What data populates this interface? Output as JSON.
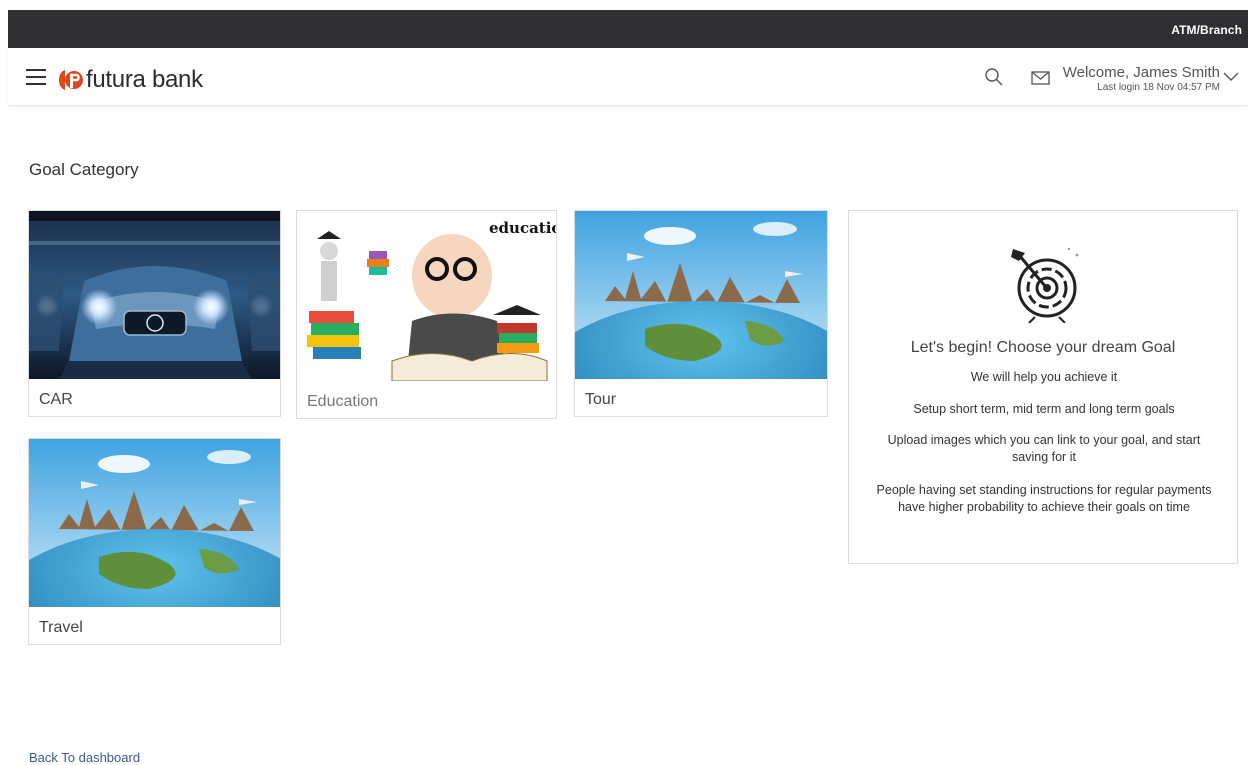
{
  "topbar": {
    "branch_label": "ATM/Branch"
  },
  "header": {
    "brand": "futura bank",
    "welcome": "Welcome, James Smith",
    "last_login": "Last login 18 Nov 04:57 PM"
  },
  "page": {
    "title": "Goal Category",
    "back_link": "Back To dashboard"
  },
  "categories": [
    {
      "label": "CAR",
      "image": "car-photo"
    },
    {
      "label": "Education",
      "image": "education-photo",
      "caption": "education"
    },
    {
      "label": "Tour",
      "image": "world-landmarks-photo"
    },
    {
      "label": "Travel",
      "image": "world-landmarks-photo"
    }
  ],
  "info_panel": {
    "icon": "target-icon",
    "headline": "Let's begin! Choose your dream Goal",
    "line1": "We will help you achieve it",
    "line2": "Setup short term, mid term and long term goals",
    "line3": "Upload images which you can link to your goal, and start saving for it",
    "line4": "People having set standing instructions for regular payments have higher probability to achieve their goals on time"
  },
  "colors": {
    "topbar": "#2f2f31",
    "brand": "#e2461f",
    "link": "#3a5a95"
  }
}
